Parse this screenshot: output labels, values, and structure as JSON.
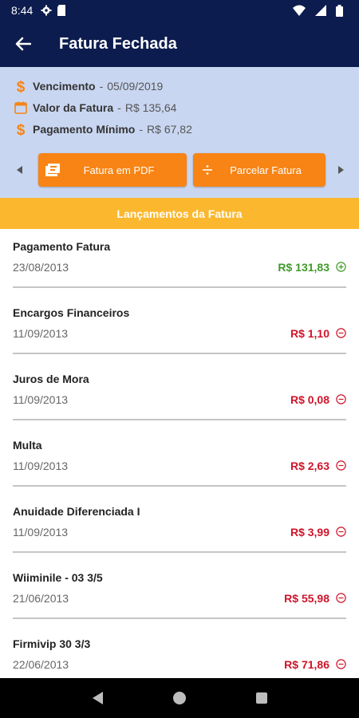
{
  "status_bar": {
    "time": "8:44"
  },
  "app_bar": {
    "title": "Fatura Fechada"
  },
  "summary": {
    "due_label": "Vencimento",
    "due_value": "05/09/2019",
    "total_label": "Valor da Fatura",
    "total_value": "R$ 135,64",
    "minimum_label": "Pagamento Mínimo",
    "minimum_value": "R$ 67,82",
    "separator": "-"
  },
  "actions": {
    "pdf_label": "Fatura em PDF",
    "installment_label": "Parcelar Fatura"
  },
  "section": {
    "title": "Lançamentos da Fatura"
  },
  "transactions": [
    {
      "name": "Pagamento Fatura",
      "date": "23/08/2013",
      "amount": "R$ 131,83",
      "type": "credit"
    },
    {
      "name": "Encargos Financeiros",
      "date": "11/09/2013",
      "amount": "R$ 1,10",
      "type": "debit"
    },
    {
      "name": "Juros de Mora",
      "date": "11/09/2013",
      "amount": "R$ 0,08",
      "type": "debit"
    },
    {
      "name": "Multa",
      "date": "11/09/2013",
      "amount": "R$ 2,63",
      "type": "debit"
    },
    {
      "name": "Anuidade Diferenciada I",
      "date": "11/09/2013",
      "amount": "R$ 3,99",
      "type": "debit"
    },
    {
      "name": "Wiiminile - 03 3/5",
      "date": "21/06/2013",
      "amount": "R$ 55,98",
      "type": "debit"
    },
    {
      "name": "Firmivip 30 3/3",
      "date": "22/06/2013",
      "amount": "R$ 71,86",
      "type": "debit"
    }
  ],
  "colors": {
    "primary": "#0d1c4e",
    "summary_bg": "#c9d6f1",
    "accent": "#f78415",
    "section_bg": "#fbb82f",
    "credit": "#3f9a29",
    "debit": "#d0142a"
  },
  "icons": {
    "status": [
      "gear-icon",
      "sd-card-icon",
      "wifi-icon",
      "signal-icon",
      "battery-icon"
    ],
    "summary": [
      "dollar-icon",
      "calendar-icon",
      "dollar-icon"
    ],
    "actions": [
      "pdf-icon",
      "divide-icon"
    ],
    "nav": [
      "back-triangle-icon",
      "home-circle-icon",
      "recents-square-icon"
    ]
  }
}
